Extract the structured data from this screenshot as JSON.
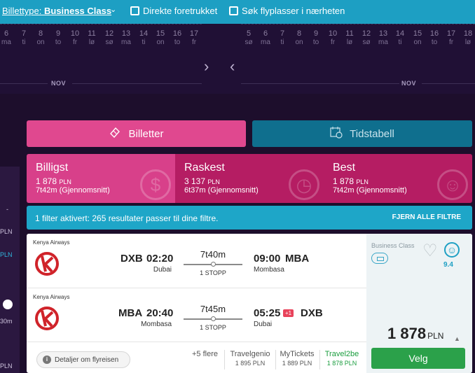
{
  "topbar": {
    "ticket_prefix": "Billettype: ",
    "ticket_value": "Business Class",
    "direct_label": "Direkte foretrukket",
    "nearby_label": "Søk flyplasser i nærheten"
  },
  "datestrip": {
    "left": {
      "days": [
        {
          "n": "6",
          "w": "ma"
        },
        {
          "n": "7",
          "w": "ti"
        },
        {
          "n": "8",
          "w": "on"
        },
        {
          "n": "9",
          "w": "to"
        },
        {
          "n": "10",
          "w": "fr"
        },
        {
          "n": "11",
          "w": "lø"
        },
        {
          "n": "12",
          "w": "sø"
        },
        {
          "n": "13",
          "w": "ma"
        },
        {
          "n": "14",
          "w": "ti"
        },
        {
          "n": "15",
          "w": "on"
        },
        {
          "n": "16",
          "w": "to"
        },
        {
          "n": "17",
          "w": "fr"
        }
      ],
      "month": "NOV"
    },
    "right": {
      "days": [
        {
          "n": "5",
          "w": "sø"
        },
        {
          "n": "6",
          "w": "ma"
        },
        {
          "n": "7",
          "w": "ti"
        },
        {
          "n": "8",
          "w": "on"
        },
        {
          "n": "9",
          "w": "to"
        },
        {
          "n": "10",
          "w": "fr"
        },
        {
          "n": "11",
          "w": "lø"
        },
        {
          "n": "12",
          "w": "sø"
        },
        {
          "n": "13",
          "w": "ma"
        },
        {
          "n": "14",
          "w": "ti"
        },
        {
          "n": "15",
          "w": "on"
        },
        {
          "n": "16",
          "w": "to"
        },
        {
          "n": "17",
          "w": "fr"
        },
        {
          "n": "18",
          "w": "lø"
        }
      ],
      "month": "NOV"
    }
  },
  "leftpanel": {
    "a": "-",
    "b": "PLN",
    "c": "PLN",
    "d": "30m",
    "e": "PLN"
  },
  "tabs": {
    "tickets": "Billetter",
    "schedule": "Tidstabell"
  },
  "sort": {
    "cheapest": {
      "title": "Billigst",
      "price": "1 878",
      "currency": "PLN",
      "duration": "7t42m (Gjennomsnitt)"
    },
    "fastest": {
      "title": "Raskest",
      "price": "3 137",
      "currency": "PLN",
      "duration": "6t37m (Gjennomsnitt)"
    },
    "best": {
      "title": "Best",
      "price": "1 878",
      "currency": "PLN",
      "duration": "7t42m (Gjennomsnitt)"
    }
  },
  "notice": {
    "message": "1 filter aktivert: 265 resultater passer til dine filtre.",
    "clear": "FJERN ALLE FILTRE"
  },
  "result": {
    "outbound": {
      "airline": "Kenya Airways",
      "from": "DXB",
      "dep_time": "02:20",
      "from_city": "Dubai",
      "duration": "7t40m",
      "stops": "1 STOPP",
      "arr_time": "09:00",
      "to": "MBA",
      "to_city": "Mombasa"
    },
    "return": {
      "airline": "Kenya Airways",
      "from": "MBA",
      "dep_time": "20:40",
      "from_city": "Mombasa",
      "duration": "7t45m",
      "stops": "1 STOPP",
      "arr_time": "05:25",
      "next_day": "+1",
      "to": "DXB",
      "to_city": "Dubai"
    },
    "details_label": "Detaljer om flyreisen",
    "more_label": "+5 flere",
    "providers": [
      {
        "name": "Travelgenio",
        "price": "1 895 PLN"
      },
      {
        "name": "MyTickets",
        "price": "1 889 PLN"
      },
      {
        "name": "Travel2be",
        "price": "1 878 PLN"
      }
    ],
    "cabin": "Business Class",
    "score": "9.4",
    "price": "1 878",
    "currency": "PLN",
    "select_label": "Velg"
  }
}
